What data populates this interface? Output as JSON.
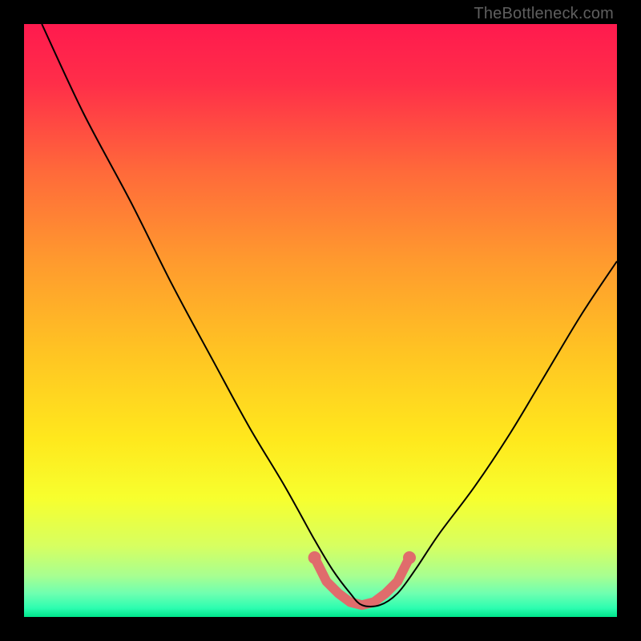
{
  "watermark": "TheBottleneck.com",
  "gradient": {
    "stops": [
      {
        "offset": 0.0,
        "color": "#ff1a4e"
      },
      {
        "offset": 0.1,
        "color": "#ff2e49"
      },
      {
        "offset": 0.25,
        "color": "#ff6a3a"
      },
      {
        "offset": 0.4,
        "color": "#ff9a2e"
      },
      {
        "offset": 0.55,
        "color": "#ffc323"
      },
      {
        "offset": 0.7,
        "color": "#ffe81d"
      },
      {
        "offset": 0.8,
        "color": "#f7ff2e"
      },
      {
        "offset": 0.88,
        "color": "#d7ff60"
      },
      {
        "offset": 0.93,
        "color": "#a8ff90"
      },
      {
        "offset": 0.96,
        "color": "#6fffb0"
      },
      {
        "offset": 0.985,
        "color": "#2dfdb0"
      },
      {
        "offset": 1.0,
        "color": "#00e58b"
      }
    ]
  },
  "chart_data": {
    "type": "line",
    "title": "",
    "xlabel": "",
    "ylabel": "",
    "xlim": [
      0,
      100
    ],
    "ylim": [
      0,
      100
    ],
    "series": [
      {
        "name": "bottleneck-curve",
        "x": [
          3,
          10,
          18,
          25,
          32,
          38,
          44,
          49,
          52,
          55,
          57,
          60,
          63,
          66,
          70,
          76,
          82,
          88,
          94,
          100
        ],
        "values": [
          100,
          85,
          70,
          56,
          43,
          32,
          22,
          13,
          8,
          4,
          2,
          2,
          4,
          8,
          14,
          22,
          31,
          41,
          51,
          60
        ]
      }
    ],
    "highlight": {
      "name": "trough-highlight",
      "color": "#e06c6c",
      "x": [
        49,
        51,
        53,
        55,
        57,
        59,
        61,
        63,
        65
      ],
      "values": [
        10,
        6,
        4,
        2.5,
        2,
        2.5,
        4,
        6,
        10
      ]
    }
  }
}
